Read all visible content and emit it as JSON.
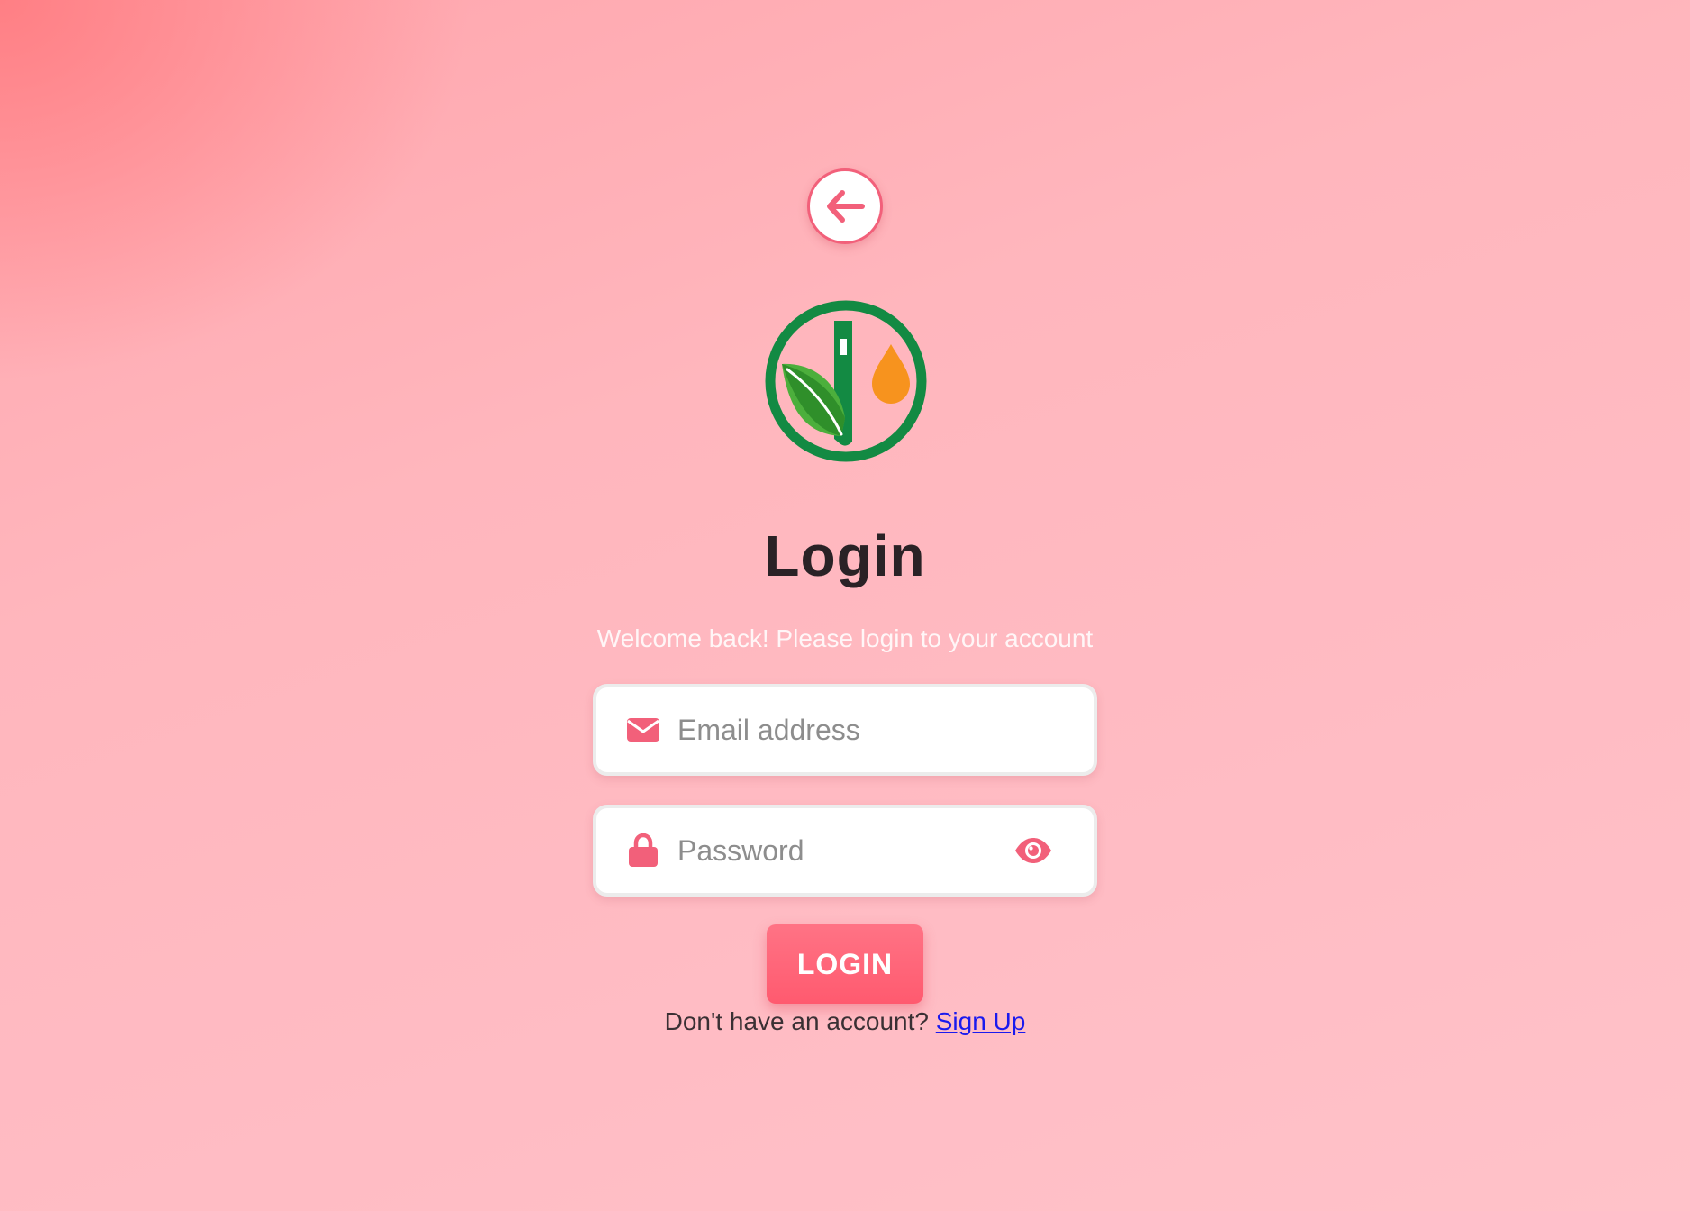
{
  "page": {
    "title": "Login",
    "subtitle": "Welcome back! Please login to your account"
  },
  "back_button": {
    "icon": "arrow-left-icon"
  },
  "logo": {
    "icon": "leaf-drop-logo-icon",
    "colors": {
      "ring": "#138a43",
      "leaf": "#4caf3c",
      "drop": "#f7931e"
    }
  },
  "form": {
    "email": {
      "placeholder": "Email address",
      "value": "",
      "icon": "envelope-icon"
    },
    "password": {
      "placeholder": "Password",
      "value": "",
      "icon": "lock-icon",
      "toggle_icon": "eye-icon"
    },
    "submit_label": "LOGIN"
  },
  "signup": {
    "prompt": "Don't have an account?",
    "link_label": "Sign Up"
  },
  "colors": {
    "accent": "#ff5a6f",
    "link": "#1a1aee",
    "title": "#2a2226"
  }
}
